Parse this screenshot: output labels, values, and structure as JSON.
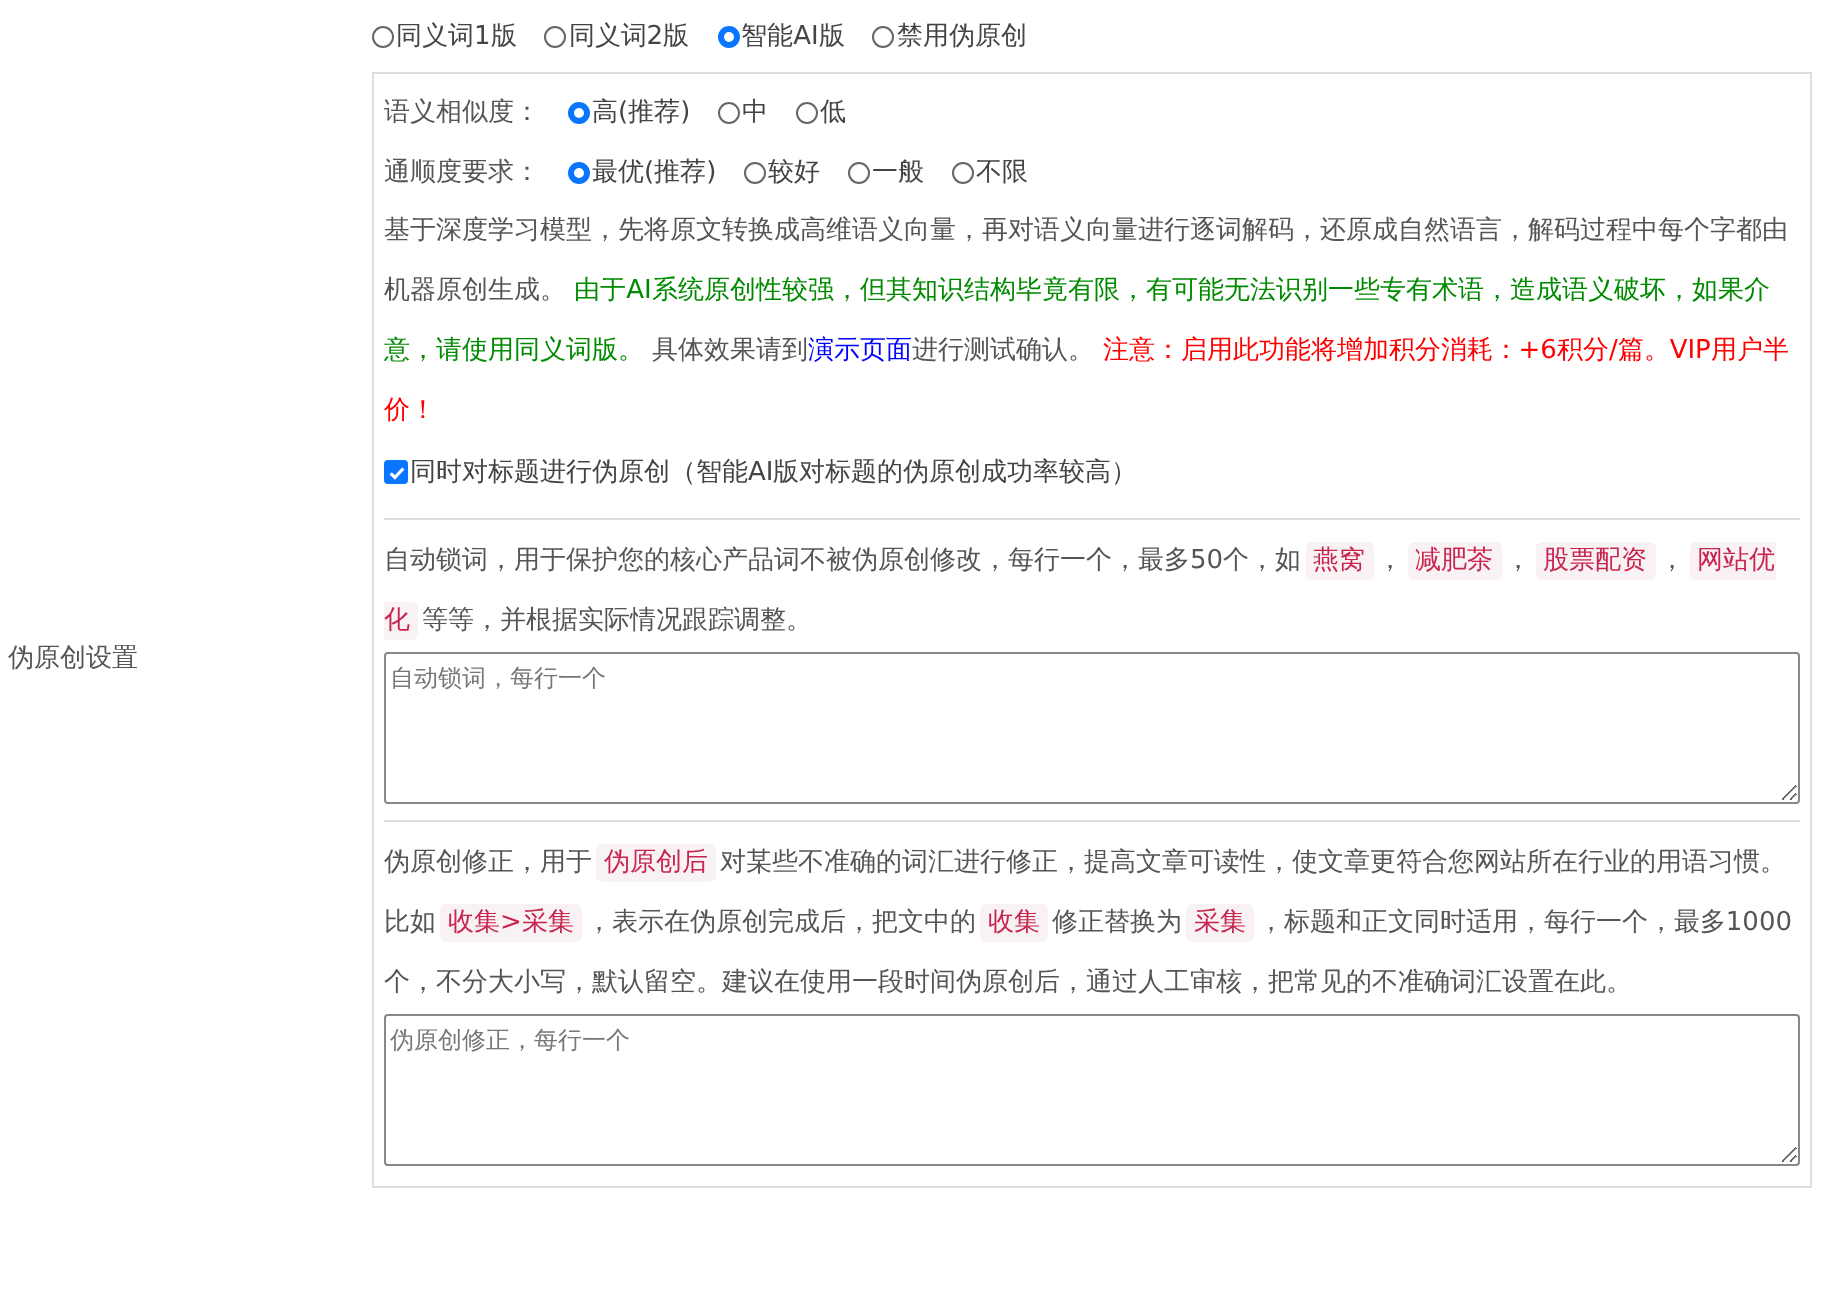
{
  "side_label": "伪原创设置",
  "modes": [
    {
      "label": "同义词1版",
      "selected": false
    },
    {
      "label": "同义词2版",
      "selected": false
    },
    {
      "label": "智能AI版",
      "selected": true
    },
    {
      "label": "禁用伪原创",
      "selected": false
    }
  ],
  "similarity": {
    "label": "语义相似度：",
    "options": [
      {
        "label": "高(推荐)",
        "selected": true
      },
      {
        "label": "中",
        "selected": false
      },
      {
        "label": "低",
        "selected": false
      }
    ]
  },
  "fluency": {
    "label": "通顺度要求：",
    "options": [
      {
        "label": "最优(推荐)",
        "selected": true
      },
      {
        "label": "较好",
        "selected": false
      },
      {
        "label": "一般",
        "selected": false
      },
      {
        "label": "不限",
        "selected": false
      }
    ]
  },
  "description": [
    {
      "kind": "plain",
      "text": "基于深度学习模型，先将原文转换成高维语义向量，再对语义向量进行逐词解码，还原成自然语言，解码过程中每个字都由机器原创生成。 "
    },
    {
      "kind": "green",
      "text": "由于AI系统原创性较强，但其知识结构毕竟有限，有可能无法识别一些专有术语，造成语义破坏，如果介意，请使用同义词版。"
    },
    {
      "kind": "plain",
      "text": " 具体效果请到"
    },
    {
      "kind": "link",
      "text": "演示页面"
    },
    {
      "kind": "plain",
      "text": "进行测试确认。 "
    },
    {
      "kind": "red",
      "text": "注意：启用此功能将增加积分消耗：+6积分/篇。VIP用户半价！"
    }
  ],
  "title_option": {
    "label": "同时对标题进行伪原创（智能AI版对标题的伪原创成功率较高）",
    "checked": true
  },
  "lock_words": {
    "description": [
      {
        "kind": "plain",
        "text": "自动锁词，用于保护您的核心产品词不被伪原创修改，每行一个，最多50个，如"
      },
      {
        "kind": "code",
        "text": "燕窝"
      },
      {
        "kind": "plain",
        "text": "，"
      },
      {
        "kind": "code",
        "text": "减肥茶"
      },
      {
        "kind": "plain",
        "text": "，"
      },
      {
        "kind": "code",
        "text": "股票配资"
      },
      {
        "kind": "plain",
        "text": "，"
      },
      {
        "kind": "code",
        "text": "网站优化"
      },
      {
        "kind": "plain",
        "text": "等等，并根据实际情况跟踪调整。"
      }
    ],
    "placeholder": "自动锁词，每行一个"
  },
  "corrections": {
    "description": [
      {
        "kind": "plain",
        "text": "伪原创修正，用于"
      },
      {
        "kind": "code",
        "text": "伪原创后"
      },
      {
        "kind": "plain",
        "text": "对某些不准确的词汇进行修正，提高文章可读性，使文章更符合您网站所在行业的用语习惯。比如"
      },
      {
        "kind": "code",
        "text": "收集>采集"
      },
      {
        "kind": "plain",
        "text": "，表示在伪原创完成后，把文中的"
      },
      {
        "kind": "code",
        "text": "收集"
      },
      {
        "kind": "plain",
        "text": "修正替换为"
      },
      {
        "kind": "code",
        "text": "采集"
      },
      {
        "kind": "plain",
        "text": "，标题和正文同时适用，每行一个，最多1000个，不分大小写，默认留空。建议在使用一段时间伪原创后，通过人工审核，把常见的不准确词汇设置在此。"
      }
    ],
    "placeholder": "伪原创修正，每行一个"
  }
}
